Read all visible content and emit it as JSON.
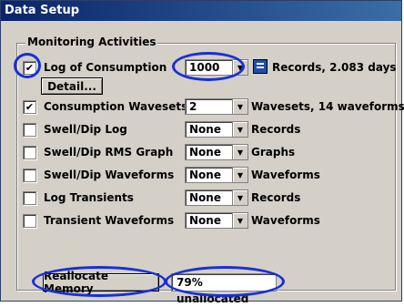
{
  "window": {
    "title": "Data Setup"
  },
  "group": {
    "title": "Monitoring Activities"
  },
  "rows": [
    {
      "label": "Log of Consumption",
      "checked": true,
      "value": "1000",
      "suffix": "Records, 2.083 days"
    },
    {
      "label": "Consumption Wavesets",
      "checked": true,
      "value": "2",
      "suffix": "Wavesets, 14 waveforms"
    },
    {
      "label": "Swell/Dip Log",
      "checked": false,
      "value": "None",
      "suffix": "Records"
    },
    {
      "label": "Swell/Dip RMS Graph",
      "checked": false,
      "value": "None",
      "suffix": "Graphs"
    },
    {
      "label": "Swell/Dip Waveforms",
      "checked": false,
      "value": "None",
      "suffix": "Waveforms"
    },
    {
      "label": "Log Transients",
      "checked": false,
      "value": "None",
      "suffix": "Records"
    },
    {
      "label": "Transient Waveforms",
      "checked": false,
      "value": "None",
      "suffix": "Waveforms"
    }
  ],
  "detail_button": "Detail...",
  "reallocate_button": "Reallocate Memory",
  "memory_status": "79% unallocated",
  "icons": {
    "checkbox_checked": "✔",
    "dropdown": "▼",
    "memory": "memory-icon"
  },
  "colors": {
    "title_bar": "#0a246a",
    "annotation_ovals": "#1a2fd6",
    "dialog_bg": "#d4d0c8"
  }
}
